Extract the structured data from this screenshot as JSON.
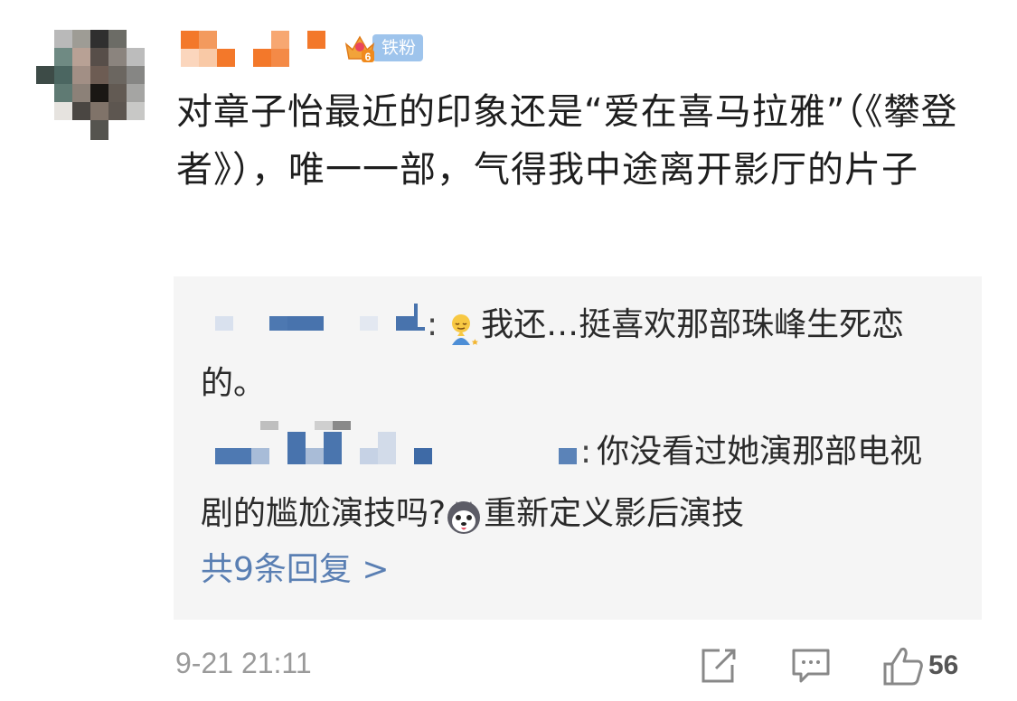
{
  "badge": {
    "level": "6",
    "label": "铁粉"
  },
  "comment": {
    "text": "对章子怡最近的印象还是“爱在喜马拉雅”（《攀登者》），唯一一部，气得我中途离开影厅的片子"
  },
  "replies": [
    {
      "separator": ":",
      "text": "我还…挺喜欢那部珠峰生死恋的。"
    },
    {
      "separator": ":",
      "text_before_emoji": "你没看过她演那部电视剧的尴尬演技吗?",
      "text_after_emoji": "重新定义影后演技"
    }
  ],
  "more_replies": "共9条回复 >",
  "meta": {
    "time": "9-21 21:11",
    "like_count": "56"
  },
  "icons": {
    "badge_crown": "crown-icon",
    "reply1_emoji": "praying-emoji-icon",
    "reply2_emoji": "husky-emoji-icon",
    "share": "share-icon",
    "comment": "comment-icon",
    "like": "thumbs-up-icon"
  },
  "colors": {
    "link": "#5a7fb3",
    "badge_bg": "#9ec4ec",
    "reply_bg": "#f5f5f5",
    "meta": "#9a9a9a"
  }
}
